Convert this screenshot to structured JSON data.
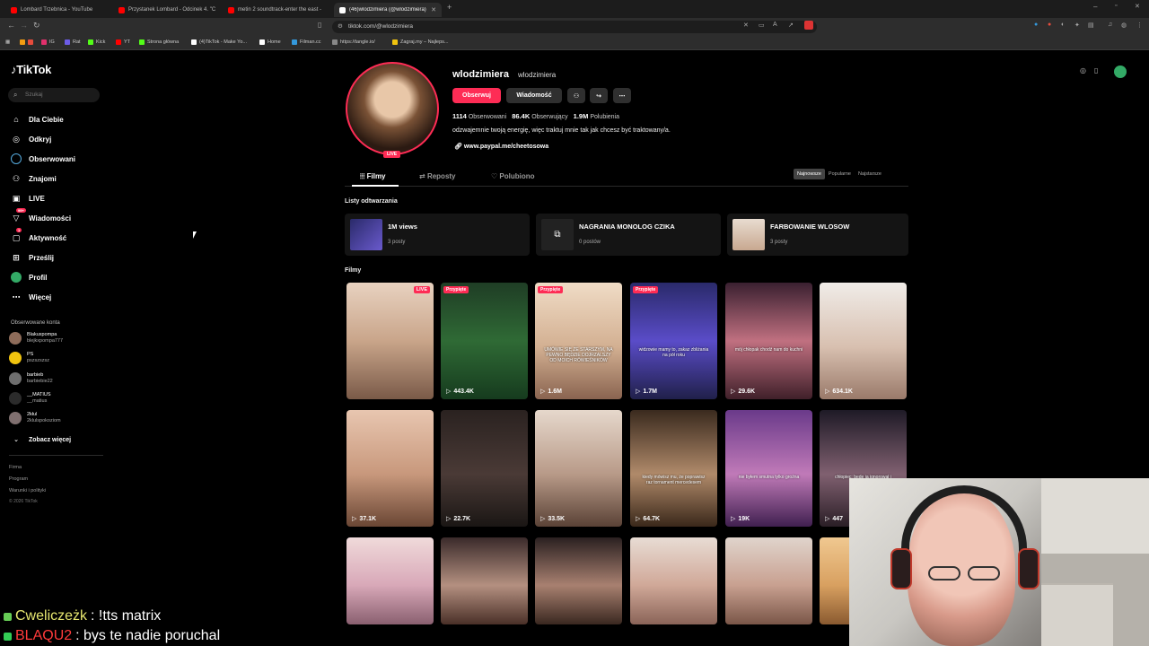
{
  "browser": {
    "tabs": [
      {
        "title": "Lombard Trzebnica - YouTube",
        "color": "#ff0000"
      },
      {
        "title": "Przystanek Lombard - Odcinek 4. \"C",
        "color": "#ff0000"
      },
      {
        "title": "metin 2 soundtrack-enter the east -",
        "color": "#ff0000"
      },
      {
        "title": "(46)wlodzimiera (@wlodzimiera)",
        "color": "#ffffff"
      }
    ],
    "url": "tiktok.com/@wlodzimiera",
    "bookmarks": [
      {
        "label": "IG",
        "color": "#e1306c"
      },
      {
        "label": "Rat",
        "color": "#6c5ce7"
      },
      {
        "label": "Kick",
        "color": "#53fc18"
      },
      {
        "label": "YT",
        "color": "#ff0000"
      },
      {
        "label": "Strona główna",
        "color": "#53fc18"
      },
      {
        "label": "(4)TikTok - Make Yo...",
        "color": "#ffffff"
      },
      {
        "label": "Home",
        "color": "#ffffff"
      },
      {
        "label": "Filman.cc",
        "color": "#3498db"
      },
      {
        "label": "https://tangle.io/",
        "color": "#888888"
      },
      {
        "label": "Zagraj.my – Najleps...",
        "color": "#f1c40f"
      }
    ]
  },
  "sidebar": {
    "logo": "TikTok",
    "search_placeholder": "Szukaj",
    "nav": [
      {
        "label": "Dla Ciebie",
        "icon": "home-icon"
      },
      {
        "label": "Odkryj",
        "icon": "compass-icon"
      },
      {
        "label": "Obserwowani",
        "icon": "following-icon"
      },
      {
        "label": "Znajomi",
        "icon": "friends-icon"
      },
      {
        "label": "LIVE",
        "icon": "live-icon"
      },
      {
        "label": "Wiadomości",
        "icon": "messages-icon",
        "badge": "99+"
      },
      {
        "label": "Aktywność",
        "icon": "activity-icon",
        "badge": "1"
      },
      {
        "label": "Prześlij",
        "icon": "upload-icon"
      },
      {
        "label": "Profil",
        "icon": "profile-icon"
      },
      {
        "label": "Więcej",
        "icon": "more-icon"
      }
    ],
    "following_header": "Obserwowane konta",
    "following": [
      {
        "name": "Blakuxpompa",
        "handle": "blejkxpompa777",
        "color": "#8e6c5a"
      },
      {
        "name": "PS",
        "handle": "pszszszsz",
        "color": "#f1c40f"
      },
      {
        "name": "barbieb",
        "handle": "barbiebie22",
        "color": "#6e6e6e"
      },
      {
        "name": "__MATIUS",
        "handle": "__matius",
        "color": "#2b2b2b"
      },
      {
        "name": "2kłul",
        "handle": "2klulspokoziom",
        "color": "#7f6f6f"
      }
    ],
    "see_more": "Zobacz więcej",
    "footer": [
      "Firma",
      "Program",
      "Warunki i polityki",
      "© 2026 TikTok"
    ]
  },
  "profile": {
    "username": "wlodzimiera",
    "nickname": "wlodzimiera",
    "live_label": "LIVE",
    "follow_label": "Obserwuj",
    "message_label": "Wiadomość",
    "stats": [
      {
        "value": "1114",
        "label": "Obserwowani"
      },
      {
        "value": "86.4K",
        "label": "Obserwujący"
      },
      {
        "value": "1.9M",
        "label": "Polubienia"
      }
    ],
    "bio": "odzwajemnie twoją energię, więc traktuj mnie tak jak chcesz być traktowany/a.",
    "link": "www.paypal.me/cheetosowa"
  },
  "content_tabs": [
    "Filmy",
    "Reposty",
    "Polubiono"
  ],
  "sort": [
    "Najnowsze",
    "Popularne",
    "Najstarsze"
  ],
  "playlists_header": "Listy odtwarzania",
  "playlists": [
    {
      "title": "1M views",
      "count": "3 posty"
    },
    {
      "title": "NAGRANIA MONOLOG CZIKA",
      "count": "0 postów"
    },
    {
      "title": "FARBOWANIE WLOSOW",
      "count": "3 posty"
    }
  ],
  "videos_header": "Filmy",
  "pinned_label": "Przypięte",
  "videos": [
    {
      "views": "",
      "badge": "LIVE",
      "pinned": false,
      "caption": "",
      "bg": "linear-gradient(180deg,#e8d2c0,#c9a58a 50%,#7a5a48)"
    },
    {
      "views": "443.4K",
      "badge": "",
      "pinned": true,
      "caption": "",
      "bg": "linear-gradient(180deg,#1f3d25,#2f6a35 50%,#163b1e)"
    },
    {
      "views": "1.6M",
      "badge": "",
      "pinned": true,
      "caption": "UMÓWIE SIĘ ZE STARSZYM, NA PEWNO BĘDZIE DOJRZALSZY OD MOICH RÓWIEŚNIKÓW",
      "bg": "linear-gradient(180deg,#f0dcc6,#d3b092 55%,#8a6450)"
    },
    {
      "views": "1.7M",
      "badge": "",
      "pinned": true,
      "caption": "widzowie mamy to, zakaz zbliżania na pół roku",
      "bg": "linear-gradient(180deg,#2a2a6a,#5a4cc8 50%,#20204a)"
    },
    {
      "views": "29.6K",
      "badge": "",
      "pinned": false,
      "caption": "mój chłopak chodź nam do kuchni",
      "bg": "linear-gradient(180deg,#3a2030,#c07080 50%,#40202a)"
    },
    {
      "views": "634.1K",
      "badge": "",
      "pinned": false,
      "caption": "",
      "bg": "linear-gradient(180deg,#f0ece8,#d8c0b0 55%,#9a7a6a)"
    },
    {
      "views": "37.1K",
      "badge": "",
      "pinned": false,
      "caption": "",
      "bg": "linear-gradient(180deg,#e8c6b0,#c8987c 55%,#6a4634)"
    },
    {
      "views": "22.7K",
      "badge": "",
      "pinned": false,
      "caption": "",
      "bg": "linear-gradient(180deg,#2a2220,#4a3a36 55%,#1a1614)"
    },
    {
      "views": "33.5K",
      "badge": "",
      "pinned": false,
      "caption": "",
      "bg": "linear-gradient(180deg,#e6d8cc,#b89a88 55%,#5a4236)"
    },
    {
      "views": "64.7K",
      "badge": "",
      "pinned": false,
      "caption": "kiedy mówisz mu, że poprawisz raz tornament mercedesem",
      "bg": "linear-gradient(180deg,#3a2a1e,#b08a6a 55%,#3a281a)"
    },
    {
      "views": "19K",
      "badge": "",
      "pinned": false,
      "caption": "nie byłem smutna tylko groźna",
      "bg": "linear-gradient(180deg,#6a3a8a,#c07ab8 55%,#402050)"
    },
    {
      "views": "447",
      "badge": "",
      "pinned": false,
      "caption": "chłopiec: będę ją ignorował i będzie moja",
      "bg": "linear-gradient(180deg,#1e1a26,#806070 55%,#2a1e26)"
    },
    {
      "views": "",
      "badge": "",
      "pinned": false,
      "caption": "",
      "bg": "linear-gradient(180deg,#f0dada,#d8a8b8 55%,#8a6070)"
    },
    {
      "views": "",
      "badge": "",
      "pinned": false,
      "caption": "",
      "bg": "linear-gradient(180deg,#3a2a2a,#b49080 55%,#4a3028)"
    },
    {
      "views": "",
      "badge": "",
      "pinned": false,
      "caption": "",
      "bg": "linear-gradient(180deg,#2a2020,#a88070 55%,#3a2820)"
    },
    {
      "views": "",
      "badge": "",
      "pinned": false,
      "caption": "",
      "bg": "linear-gradient(180deg,#e8dcd4,#d0a898 55%,#8a6458)"
    },
    {
      "views": "",
      "badge": "",
      "pinned": false,
      "caption": "",
      "bg": "linear-gradient(180deg,#e0d4cc,#c8a090 55%,#7a5648)"
    },
    {
      "views": "",
      "badge": "",
      "pinned": false,
      "caption": "",
      "bg": "linear-gradient(180deg,#f0c890,#d8a060 55%,#8a5a30)"
    }
  ],
  "chat": [
    {
      "user": "Cweliczeżk",
      "user_color": "#e8e870",
      "message": ": !tts matrix"
    },
    {
      "user": "BLAQU2",
      "user_color": "#ff3b3b",
      "message": ": bys te nadie poruchal"
    }
  ],
  "colors": {
    "accent": "#fe2c55",
    "bg": "#000000"
  }
}
